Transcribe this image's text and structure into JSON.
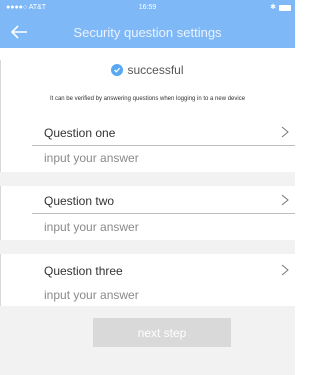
{
  "status": {
    "carrier": "●●●●○ AT&T",
    "time": "16:59"
  },
  "header": {
    "title": "Security question settings"
  },
  "success": {
    "text": "successful"
  },
  "hint": "It can be verified by answering questions when logging in to a new device",
  "questions": [
    {
      "label": "Question one",
      "answer_placeholder": "input your answer"
    },
    {
      "label": "Question two",
      "answer_placeholder": "input your answer"
    },
    {
      "label": "Question three",
      "answer_placeholder": "input your answer"
    }
  ],
  "actions": {
    "next_label": "next step"
  },
  "colors": {
    "header_bg": "#7fb8f6",
    "accent": "#59a8f2",
    "button_disabled_bg": "#d9d9d9"
  }
}
